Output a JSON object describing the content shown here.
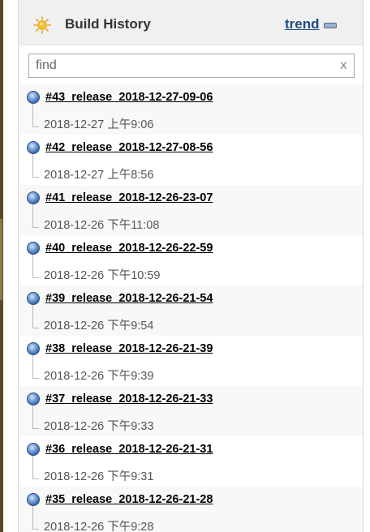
{
  "widget": {
    "title": "Build History",
    "trend_label": "trend",
    "icon": "sun-icon",
    "minimize_icon": "minimize-icon"
  },
  "search": {
    "placeholder": "find",
    "value": "",
    "clear_label": "x"
  },
  "builds": [
    {
      "name": "#43_release_2018-12-27-09-06",
      "time": "2018-12-27 上午9:06",
      "status": "success-blue"
    },
    {
      "name": "#42_release_2018-12-27-08-56",
      "time": "2018-12-27 上午8:56",
      "status": "success-blue"
    },
    {
      "name": "#41_release_2018-12-26-23-07",
      "time": "2018-12-26 下午11:08",
      "status": "success-blue"
    },
    {
      "name": "#40_release_2018-12-26-22-59",
      "time": "2018-12-26 下午10:59",
      "status": "success-blue"
    },
    {
      "name": "#39_release_2018-12-26-21-54",
      "time": "2018-12-26 下午9:54",
      "status": "success-blue"
    },
    {
      "name": "#38_release_2018-12-26-21-39",
      "time": "2018-12-26 下午9:39",
      "status": "success-blue"
    },
    {
      "name": "#37_release_2018-12-26-21-33",
      "time": "2018-12-26 下午9:33",
      "status": "success-blue"
    },
    {
      "name": "#36_release_2018-12-26-21-31",
      "time": "2018-12-26 下午9:31",
      "status": "success-blue"
    },
    {
      "name": "#35_release_2018-12-26-21-28",
      "time": "2018-12-26 下午9:28",
      "status": "success-blue"
    }
  ],
  "colors": {
    "link": "#204a87",
    "header_bg": "#f0f0f0",
    "row_alt_bg": "#f8f8f8",
    "status_blue": "#3d6db1"
  }
}
